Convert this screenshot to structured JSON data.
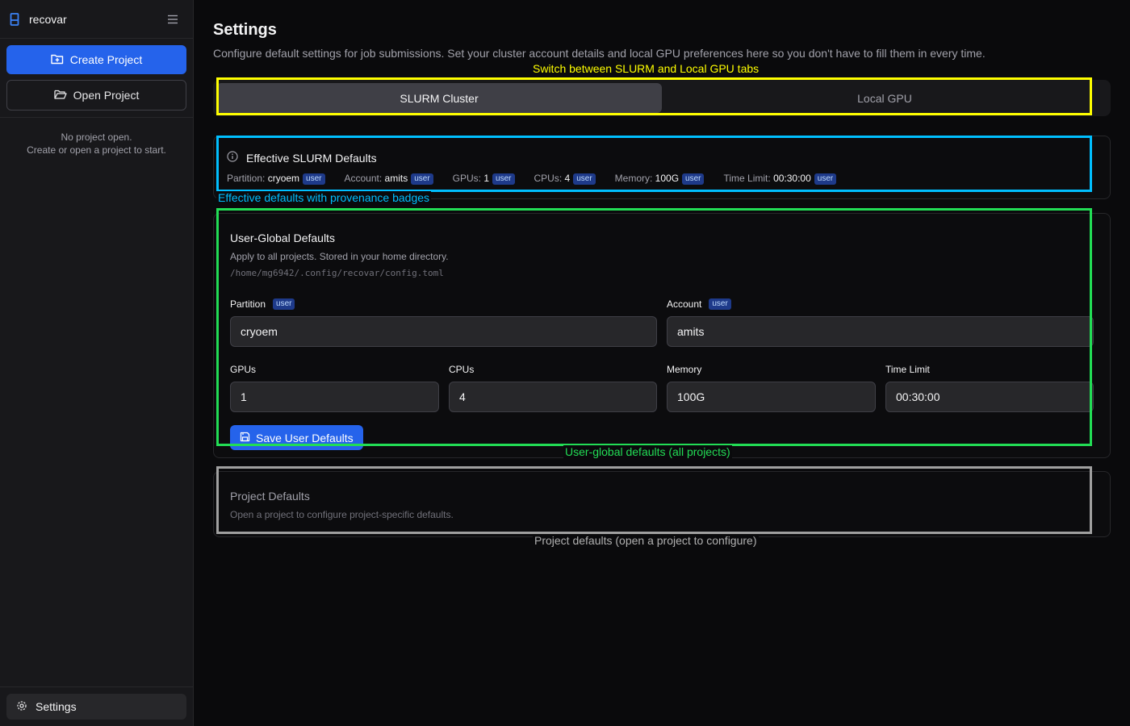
{
  "sidebar": {
    "app_name": "recovar",
    "create_project": "Create Project",
    "open_project": "Open Project",
    "empty_line1": "No project open.",
    "empty_line2": "Create or open a project to start.",
    "settings": "Settings"
  },
  "page": {
    "title": "Settings",
    "subtitle": "Configure default settings for job submissions. Set your cluster account details and local GPU preferences here so you don't have to fill them in every time."
  },
  "tabs": [
    {
      "label": "SLURM Cluster",
      "active": true
    },
    {
      "label": "Local GPU",
      "active": false
    }
  ],
  "effective": {
    "title": "Effective SLURM Defaults",
    "items": [
      {
        "label": "Partition:",
        "value": "cryoem",
        "badge": "user"
      },
      {
        "label": "Account:",
        "value": "amits",
        "badge": "user"
      },
      {
        "label": "GPUs:",
        "value": "1",
        "badge": "user"
      },
      {
        "label": "CPUs:",
        "value": "4",
        "badge": "user"
      },
      {
        "label": "Memory:",
        "value": "100G",
        "badge": "user"
      },
      {
        "label": "Time Limit:",
        "value": "00:30:00",
        "badge": "user"
      }
    ]
  },
  "user_defaults": {
    "title": "User-Global Defaults",
    "desc": "Apply to all projects. Stored in your home directory.",
    "path": "/home/mg6942/.config/recovar/config.toml",
    "partition": {
      "label": "Partition",
      "badge": "user",
      "value": "cryoem"
    },
    "account": {
      "label": "Account",
      "badge": "user",
      "value": "amits"
    },
    "gpus": {
      "label": "GPUs",
      "value": "1"
    },
    "cpus": {
      "label": "CPUs",
      "value": "4"
    },
    "memory": {
      "label": "Memory",
      "value": "100G"
    },
    "time_limit": {
      "label": "Time Limit",
      "value": "00:30:00"
    },
    "save": "Save User Defaults"
  },
  "project_defaults": {
    "title": "Project Defaults",
    "desc": "Open a project to configure project-specific defaults."
  },
  "annotations": {
    "tabs": {
      "text": "Switch between SLURM and Local GPU tabs",
      "color": "#ffff00"
    },
    "effective": {
      "text": "Effective defaults with provenance badges",
      "color": "#00bfff"
    },
    "user": {
      "text": "User-global defaults (all projects)",
      "color": "#22dd55"
    },
    "project": {
      "text": "Project defaults (open a project to configure)",
      "color": "#a0a0a0"
    }
  },
  "colors": {
    "accent": "#2563eb",
    "badge_bg": "#1e3a8a"
  }
}
